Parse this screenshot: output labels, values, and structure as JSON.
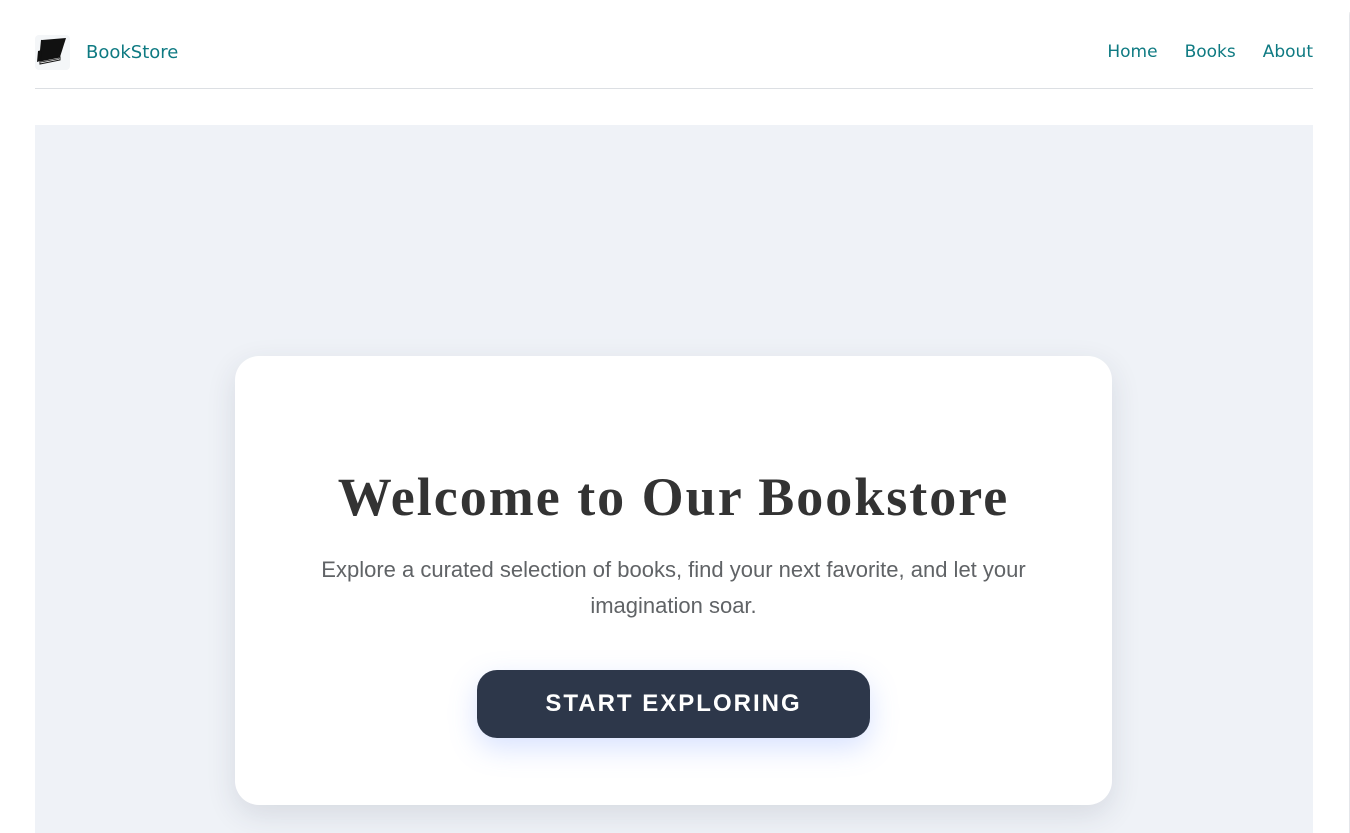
{
  "header": {
    "brand": "BookStore",
    "brand_icon": "book-icon",
    "nav": [
      {
        "label": "Home"
      },
      {
        "label": "Books"
      },
      {
        "label": "About"
      }
    ]
  },
  "hero": {
    "title": "Welcome to Our Bookstore",
    "description": "Explore a curated selection of books, find your next favorite, and let your imagination soar.",
    "cta_label": "START EXPLORING"
  },
  "colors": {
    "accent": "#0e7a82",
    "hero_background": "#eff2f7",
    "button": "#2d374a",
    "title_text": "#333333"
  }
}
